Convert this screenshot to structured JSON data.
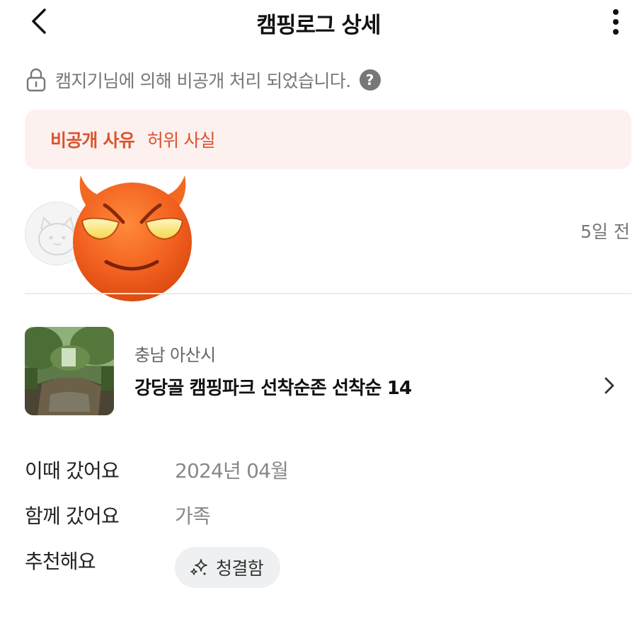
{
  "header": {
    "title": "캠핑로그 상세"
  },
  "notice": {
    "text": "캠지기님에 의해 비공개 처리 되었습니다.",
    "help_icon": "?"
  },
  "reason": {
    "label": "비공개 사유",
    "value": "허위 사실"
  },
  "author": {
    "time_ago": "5일 전"
  },
  "campsite": {
    "region": "충남 아산시",
    "name": "강당골 캠핑파크 선착순존 선착순 14"
  },
  "details": {
    "visit_label": "이때 갔어요",
    "visit_value": "2024년 04월",
    "companion_label": "함께 갔어요",
    "companion_value": "가족",
    "recommend_label": "추천해요",
    "recommend_tag": "청결함"
  },
  "colors": {
    "accent": "#d9532e",
    "reason_bg": "#fdf1ef",
    "muted_text": "#777777",
    "chip_bg": "#eef0f1"
  }
}
